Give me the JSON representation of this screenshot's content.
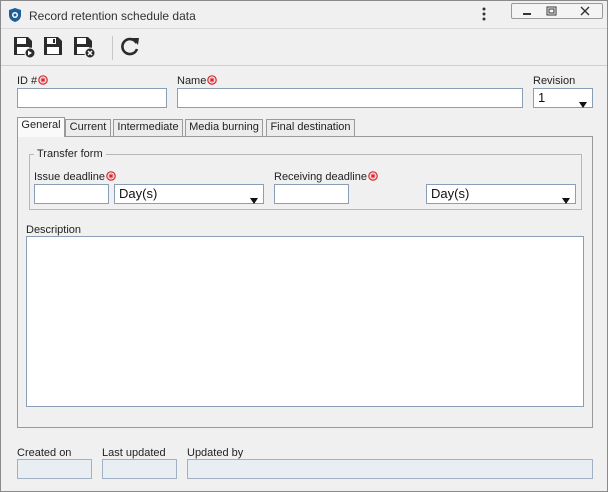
{
  "window": {
    "title": "Record retention schedule data",
    "app_icon": "shield-app-icon",
    "controls": [
      "minimize-icon",
      "maximize-icon",
      "close-icon"
    ]
  },
  "toolbar": {
    "buttons": [
      "save-and-new-icon",
      "save-icon",
      "save-and-close-icon",
      "refresh-icon"
    ]
  },
  "form": {
    "id_label": "ID #",
    "id_value": "",
    "name_label": "Name",
    "name_value": "",
    "revision_label": "Revision",
    "revision_value": "1"
  },
  "tabs": [
    {
      "label": "General",
      "active": true
    },
    {
      "label": "Current",
      "active": false
    },
    {
      "label": "Intermediate",
      "active": false
    },
    {
      "label": "Media burning",
      "active": false
    },
    {
      "label": "Final destination",
      "active": false
    }
  ],
  "general": {
    "transfer_form_legend": "Transfer form",
    "issue_deadline_label": "Issue deadline",
    "issue_deadline_value": "",
    "issue_unit": "Day(s)",
    "receiving_deadline_label": "Receiving deadline",
    "receiving_deadline_value": "",
    "receiving_unit": "Day(s)",
    "description_label": "Description",
    "description_value": ""
  },
  "footer": {
    "created_on_label": "Created on",
    "created_on_value": "",
    "last_updated_label": "Last updated",
    "last_updated_value": "",
    "updated_by_label": "Updated by",
    "updated_by_value": ""
  },
  "colors": {
    "required_marker": "#d9262c",
    "input_border": "#8a9fb5",
    "readonly_bg": "#e9eef3",
    "app_icon_blue": "#1e5d96"
  }
}
